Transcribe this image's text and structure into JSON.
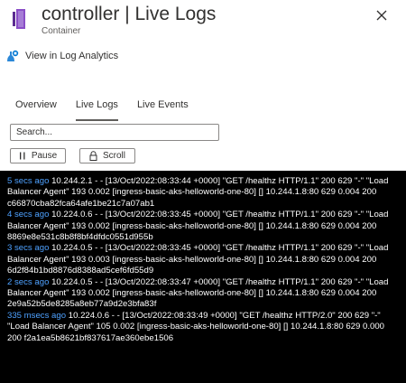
{
  "header": {
    "title": "controller | Live Logs",
    "subtitle": "Container",
    "accent_color": "#8a4ec7",
    "close_icon": "close-icon"
  },
  "log_analytics": {
    "label": "View in Log Analytics",
    "icon": "log-analytics-icon"
  },
  "tabs": [
    {
      "label": "Overview",
      "active": false
    },
    {
      "label": "Live Logs",
      "active": true
    },
    {
      "label": "Live Events",
      "active": false
    }
  ],
  "search": {
    "placeholder": "Search...",
    "value": ""
  },
  "buttons": {
    "pause_label": "Pause",
    "scroll_label": "Scroll"
  },
  "logs": [
    {
      "time": "5 secs ago",
      "text": " 10.244.2.1 - - [13/Oct/2022:08:33:44 +0000] \"GET /healthz HTTP/1.1\" 200 629 \"-\" \"Load Balancer Agent\" 193 0.002 [ingress-basic-aks-helloworld-one-80] [] 10.244.1.8:80 629 0.004 200 c66870cba82fca64afe1be21c7a07ab1"
    },
    {
      "time": "4 secs ago",
      "text": " 10.224.0.6 - - [13/Oct/2022:08:33:45 +0000] \"GET /healthz HTTP/1.1\" 200 629 \"-\" \"Load Balancer Agent\" 193 0.002 [ingress-basic-aks-helloworld-one-80] [] 10.244.1.8:80 629 0.004 200 8869e8e531c8b8f8bf4dfdc0551d955b"
    },
    {
      "time": "3 secs ago",
      "text": " 10.224.0.5 - - [13/Oct/2022:08:33:45 +0000] \"GET /healthz HTTP/1.1\" 200 629 \"-\" \"Load Balancer Agent\" 193 0.003 [ingress-basic-aks-helloworld-one-80] [] 10.244.1.8:80 629 0.004 200 6d2f84b1bd8876d8388ad5cef6fd55d9"
    },
    {
      "time": "2 secs ago",
      "text": " 10.224.0.5 - - [13/Oct/2022:08:33:47 +0000] \"GET /healthz HTTP/1.1\" 200 629 \"-\" \"Load Balancer Agent\" 193 0.002 [ingress-basic-aks-helloworld-one-80] [] 10.244.1.8:80 629 0.004 200 2e9a52b5de8285a8eb77a9d2e3bfa83f"
    },
    {
      "time": "335 msecs ago",
      "text": " 10.224.0.6 - - [13/Oct/2022:08:33:49 +0000] \"GET /healthz HTTP/2.0\" 200 629 \"-\" \"Load Balancer Agent\" 105 0.002 [ingress-basic-aks-helloworld-one-80] [] 10.244.1.8:80 629 0.000 200 f2a1ea5b8621bf837617ae360ebe1506"
    }
  ]
}
